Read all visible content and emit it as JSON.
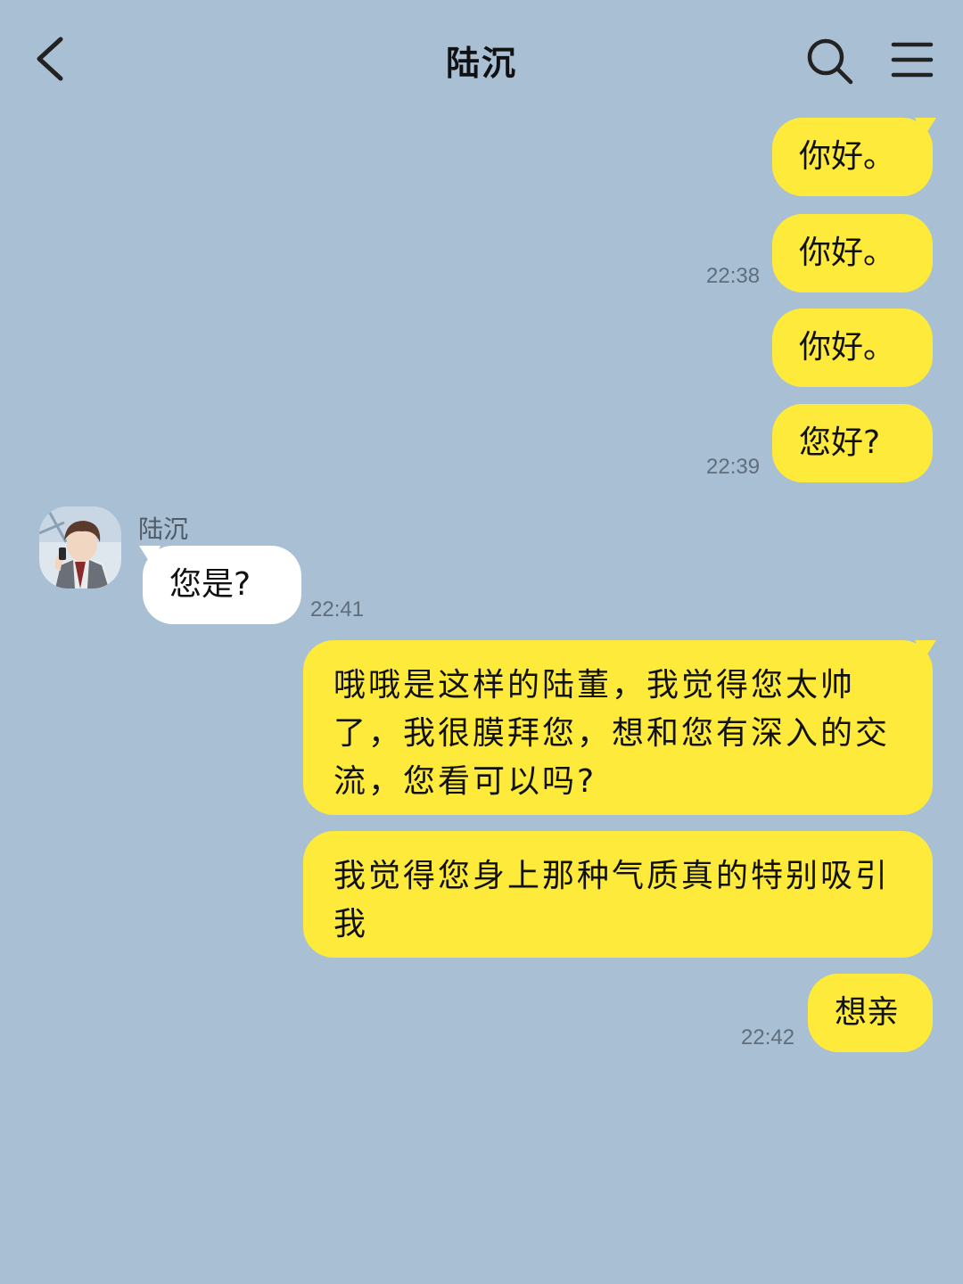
{
  "header": {
    "title": "陆沉",
    "back_icon": "chevron-left-icon",
    "search_icon": "search-icon",
    "menu_icon": "hamburger-menu-icon"
  },
  "colors": {
    "background": "#a9bfd4",
    "outgoing_bubble": "#fdea3a",
    "incoming_bubble": "#ffffff",
    "timestamp": "#5f6e7c"
  },
  "messages": [
    {
      "direction": "out",
      "text": "你好。"
    },
    {
      "direction": "out",
      "text": "你好。",
      "time": "22:38"
    },
    {
      "direction": "out",
      "text": "你好。"
    },
    {
      "direction": "out",
      "text": "您好?",
      "time": "22:39"
    },
    {
      "direction": "in",
      "sender": "陆沉",
      "text": "您是?",
      "time": "22:41"
    },
    {
      "direction": "out",
      "lines": [
        "哦哦是这样的陆董，我觉得您太帅",
        "了，我很膜拜您，想和您有深入的交",
        "流，您看可以吗?"
      ]
    },
    {
      "direction": "out",
      "lines": [
        "我觉得您身上那种气质真的特别吸引",
        "我"
      ]
    },
    {
      "direction": "out",
      "text": "想亲",
      "time": "22:42"
    }
  ]
}
